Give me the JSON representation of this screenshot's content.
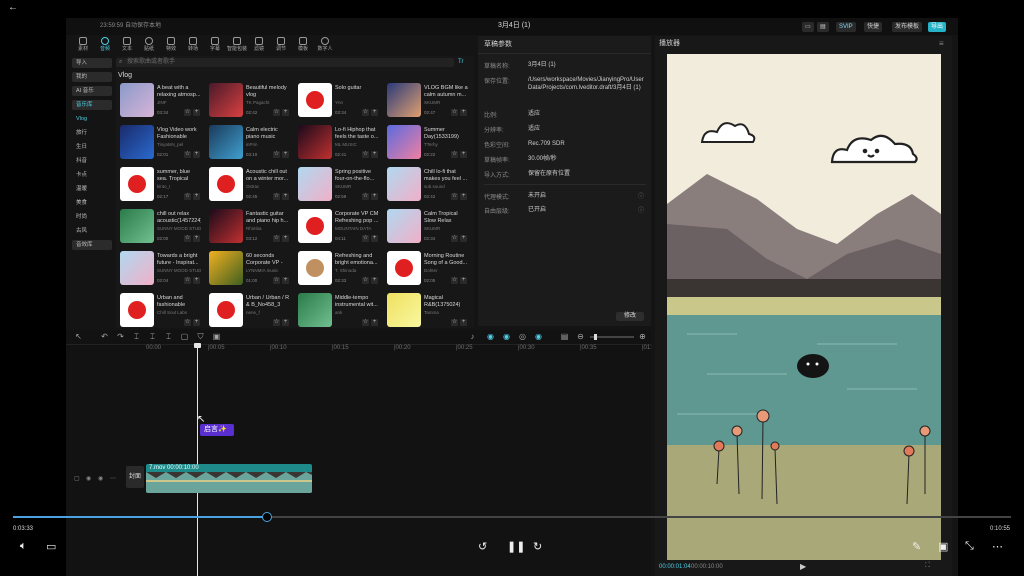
{
  "titlebar": {
    "timestamp": "23:59:59 自动保存本地",
    "project_name": "3月4日 (1)",
    "vip": "SVIP",
    "btn_shortcut": "快捷",
    "btn_publish": "发布模板",
    "btn_export": "导出"
  },
  "toolbar": [
    {
      "label": "素材"
    },
    {
      "label": "音频"
    },
    {
      "label": "文本"
    },
    {
      "label": "贴纸"
    },
    {
      "label": "特效"
    },
    {
      "label": "转场"
    },
    {
      "label": "字幕"
    },
    {
      "label": "智能包装"
    },
    {
      "label": "滤镜"
    },
    {
      "label": "调节"
    },
    {
      "label": "模板"
    },
    {
      "label": "数字人"
    }
  ],
  "sidebar": {
    "items": [
      "导入",
      "我的",
      "AI 音乐",
      "音乐库",
      "Vlog",
      "旅行",
      "生日",
      "抖音",
      "卡点",
      "温暖",
      "美食",
      "时尚",
      "古风",
      "音效库"
    ]
  },
  "media": {
    "search_placeholder": "搜索歌曲或者歌手",
    "category_title": "Vlog",
    "filter_label": "Tr",
    "cards": [
      {
        "title": "A beat with a relaxing atmosp...",
        "artist": "JINF",
        "duration": "03:34",
        "thumb": "#8a9ac9",
        "thumb2": "#d8b4d8"
      },
      {
        "title": "Beautiful melody vlog fashionable...",
        "artist": "TK Pagacht",
        "duration": "02:42",
        "thumb": "#4a1a2a",
        "thumb2": "#d94040"
      },
      {
        "title": "Solo guitar",
        "artist": "Ynn",
        "duration": "03:34",
        "thumb": "#ffffff",
        "thumb2": "#e02020"
      },
      {
        "title": "VLOG BGM like a calm autumn m...",
        "artist": "SKUMR",
        "duration": "02:47",
        "thumb": "#2a3a7a",
        "thumb2": "#e0a070"
      },
      {
        "title": "Vlog Video work Fashionable BG...",
        "artist": "TinyatsN_pel",
        "duration": "02:01",
        "thumb": "#1a2a6a",
        "thumb2": "#2a6ad0"
      },
      {
        "title": "Calm electric piano music with...",
        "artist": "inPrin",
        "duration": "03:10",
        "thumb": "#1a3a5a",
        "thumb2": "#40a0d0"
      },
      {
        "title": "Lo-fi Hiphop that feels the taste o...",
        "artist": "ML MUSIC",
        "duration": "02:41",
        "thumb": "#1a0a1a",
        "thumb2": "#c03030"
      },
      {
        "title": "Summer Day(1533199)",
        "artist": "TTerhy",
        "duration": "02:22",
        "thumb": "#5a6ae0",
        "thumb2": "#f080a0"
      },
      {
        "title": "summer, blue sea. Tropical house(1...",
        "artist": "kinto_I",
        "duration": "02:17",
        "thumb": "#ffffff",
        "thumb2": "#e02020"
      },
      {
        "title": "Acoustic chill out on a winter mor...",
        "artist": "Ostrac",
        "duration": "02:45",
        "thumb": "#ffffff",
        "thumb2": "#e02020"
      },
      {
        "title": "Spring positive four-on-the-flo...",
        "artist": "SKUMR",
        "duration": "02:59",
        "thumb": "#b0d8f0",
        "thumb2": "#f0b0c8"
      },
      {
        "title": "Chill lo-fi that makes you feel ...",
        "artist": "sub.sound",
        "duration": "02:42",
        "thumb": "#b0d8f0",
        "thumb2": "#f0b0c8"
      },
      {
        "title": "chill out relax acoustic(1457224)",
        "artist": "SUNNY MOOD STUDIO",
        "duration": "02:00",
        "thumb": "#2a7a4a",
        "thumb2": "#70c090"
      },
      {
        "title": "Fantastic guitar and piano hip h...",
        "artist": "Rhimba",
        "duration": "03:12",
        "thumb": "#1a0a1a",
        "thumb2": "#c03030"
      },
      {
        "title": "Corporate VP CM Refreshing pop ...",
        "artist": "MOUNTAIN DATA",
        "duration": "04:11",
        "thumb": "#ffffff",
        "thumb2": "#e02020"
      },
      {
        "title": "Calm Tropical Slow Relax Haw...",
        "artist": "SKUMR",
        "duration": "02:34",
        "thumb": "#b0d8f0",
        "thumb2": "#f0b0c8"
      },
      {
        "title": "Towards a bright future - Inspirat...",
        "artist": "SUNNY MOOD STUDIO",
        "duration": "02:04",
        "thumb": "#b0d8f0",
        "thumb2": "#f0b0c8"
      },
      {
        "title": "60 seconds Corporate VP - Fresh...",
        "artist": "LYNNMIA music",
        "duration": "01:00",
        "thumb": "#f0b020",
        "thumb2": "#406020"
      },
      {
        "title": "Refreshing and bright emotiona...",
        "artist": "T. Shinoda",
        "duration": "02:33",
        "thumb": "#ffffff",
        "thumb2": "#c09060"
      },
      {
        "title": "Morning Routine Song of a Good...",
        "artist": "Dohter",
        "duration": "02:05",
        "thumb": "#ffffff",
        "thumb2": "#e02020"
      },
      {
        "title": "Urban and fashionable jazz...",
        "artist": "Chill Soul Labs",
        "duration": "",
        "thumb": "#ffffff",
        "thumb2": "#e02020"
      },
      {
        "title": "Urban / Urban / R & B_No458_3",
        "artist": "nene_f",
        "duration": "",
        "thumb": "#ffffff",
        "thumb2": "#e02020"
      },
      {
        "title": "Middle-tempo instrumental wit...",
        "artist": "ank",
        "duration": "",
        "thumb": "#2a7a4a",
        "thumb2": "#70c090"
      },
      {
        "title": "Magical R&B(1375024)",
        "artist": "Tamma",
        "duration": "",
        "thumb": "#f0e060",
        "thumb2": "#f8f8a0"
      }
    ]
  },
  "props": {
    "title": "草稿参数",
    "rows": [
      {
        "label": "草稿名称:",
        "value": "3月4日 (1)"
      },
      {
        "label": "保存位置:",
        "value": "/Users/workspace/Movies/JianyingPro/User Data/Projects/com.lveditor.draft/3月4日 (1)"
      },
      {
        "label": "比例:",
        "value": "适应"
      },
      {
        "label": "分辨率:",
        "value": "适应"
      },
      {
        "label": "色彩空间:",
        "value": "Rec.709 SDR"
      },
      {
        "label": "草稿帧率:",
        "value": "30.00帧/秒"
      },
      {
        "label": "导入方式:",
        "value": "保留在原有位置"
      },
      {
        "label": "代理模式:",
        "value": "未开启"
      },
      {
        "label": "自由层级:",
        "value": "已开启"
      }
    ],
    "edit_button": "修改"
  },
  "player": {
    "title": "播放器",
    "time_current": "00:00:01:04",
    "time_total": "00:00:10:00"
  },
  "timeline": {
    "ruler": [
      "00:00",
      "|00:05",
      "|00:10",
      "|00:15",
      "|00:20",
      "|00:25",
      "|00:30",
      "|00:35",
      "|01:"
    ],
    "title_clip": "启言✨",
    "cover_label": "封面",
    "track_clip_label": "7.mov  00:00:10:00"
  },
  "bottombar": {
    "time_elapsed": "0:03:33",
    "time_total": "0:10:55",
    "progress": 0.254
  },
  "colors": {
    "accent": "#4fd0e6",
    "clip_purple": "#5a2fd0",
    "clip_teal": "#1f8a8a"
  }
}
